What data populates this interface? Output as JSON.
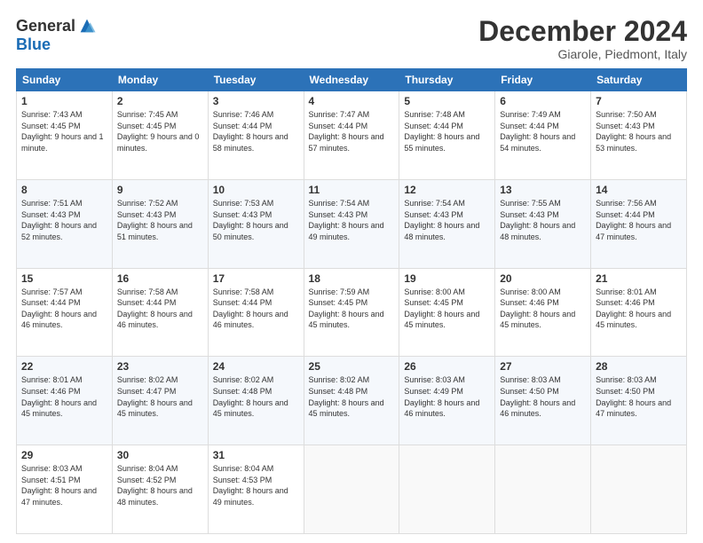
{
  "logo": {
    "general": "General",
    "blue": "Blue"
  },
  "title": {
    "month": "December 2024",
    "location": "Giarole, Piedmont, Italy"
  },
  "weekdays": [
    "Sunday",
    "Monday",
    "Tuesday",
    "Wednesday",
    "Thursday",
    "Friday",
    "Saturday"
  ],
  "weeks": [
    [
      {
        "day": "1",
        "sunrise": "7:43 AM",
        "sunset": "4:45 PM",
        "daylight": "9 hours and 1 minute."
      },
      {
        "day": "2",
        "sunrise": "7:45 AM",
        "sunset": "4:45 PM",
        "daylight": "9 hours and 0 minutes."
      },
      {
        "day": "3",
        "sunrise": "7:46 AM",
        "sunset": "4:44 PM",
        "daylight": "8 hours and 58 minutes."
      },
      {
        "day": "4",
        "sunrise": "7:47 AM",
        "sunset": "4:44 PM",
        "daylight": "8 hours and 57 minutes."
      },
      {
        "day": "5",
        "sunrise": "7:48 AM",
        "sunset": "4:44 PM",
        "daylight": "8 hours and 55 minutes."
      },
      {
        "day": "6",
        "sunrise": "7:49 AM",
        "sunset": "4:44 PM",
        "daylight": "8 hours and 54 minutes."
      },
      {
        "day": "7",
        "sunrise": "7:50 AM",
        "sunset": "4:43 PM",
        "daylight": "8 hours and 53 minutes."
      }
    ],
    [
      {
        "day": "8",
        "sunrise": "7:51 AM",
        "sunset": "4:43 PM",
        "daylight": "8 hours and 52 minutes."
      },
      {
        "day": "9",
        "sunrise": "7:52 AM",
        "sunset": "4:43 PM",
        "daylight": "8 hours and 51 minutes."
      },
      {
        "day": "10",
        "sunrise": "7:53 AM",
        "sunset": "4:43 PM",
        "daylight": "8 hours and 50 minutes."
      },
      {
        "day": "11",
        "sunrise": "7:54 AM",
        "sunset": "4:43 PM",
        "daylight": "8 hours and 49 minutes."
      },
      {
        "day": "12",
        "sunrise": "7:54 AM",
        "sunset": "4:43 PM",
        "daylight": "8 hours and 48 minutes."
      },
      {
        "day": "13",
        "sunrise": "7:55 AM",
        "sunset": "4:43 PM",
        "daylight": "8 hours and 48 minutes."
      },
      {
        "day": "14",
        "sunrise": "7:56 AM",
        "sunset": "4:44 PM",
        "daylight": "8 hours and 47 minutes."
      }
    ],
    [
      {
        "day": "15",
        "sunrise": "7:57 AM",
        "sunset": "4:44 PM",
        "daylight": "8 hours and 46 minutes."
      },
      {
        "day": "16",
        "sunrise": "7:58 AM",
        "sunset": "4:44 PM",
        "daylight": "8 hours and 46 minutes."
      },
      {
        "day": "17",
        "sunrise": "7:58 AM",
        "sunset": "4:44 PM",
        "daylight": "8 hours and 46 minutes."
      },
      {
        "day": "18",
        "sunrise": "7:59 AM",
        "sunset": "4:45 PM",
        "daylight": "8 hours and 45 minutes."
      },
      {
        "day": "19",
        "sunrise": "8:00 AM",
        "sunset": "4:45 PM",
        "daylight": "8 hours and 45 minutes."
      },
      {
        "day": "20",
        "sunrise": "8:00 AM",
        "sunset": "4:46 PM",
        "daylight": "8 hours and 45 minutes."
      },
      {
        "day": "21",
        "sunrise": "8:01 AM",
        "sunset": "4:46 PM",
        "daylight": "8 hours and 45 minutes."
      }
    ],
    [
      {
        "day": "22",
        "sunrise": "8:01 AM",
        "sunset": "4:46 PM",
        "daylight": "8 hours and 45 minutes."
      },
      {
        "day": "23",
        "sunrise": "8:02 AM",
        "sunset": "4:47 PM",
        "daylight": "8 hours and 45 minutes."
      },
      {
        "day": "24",
        "sunrise": "8:02 AM",
        "sunset": "4:48 PM",
        "daylight": "8 hours and 45 minutes."
      },
      {
        "day": "25",
        "sunrise": "8:02 AM",
        "sunset": "4:48 PM",
        "daylight": "8 hours and 45 minutes."
      },
      {
        "day": "26",
        "sunrise": "8:03 AM",
        "sunset": "4:49 PM",
        "daylight": "8 hours and 46 minutes."
      },
      {
        "day": "27",
        "sunrise": "8:03 AM",
        "sunset": "4:50 PM",
        "daylight": "8 hours and 46 minutes."
      },
      {
        "day": "28",
        "sunrise": "8:03 AM",
        "sunset": "4:50 PM",
        "daylight": "8 hours and 47 minutes."
      }
    ],
    [
      {
        "day": "29",
        "sunrise": "8:03 AM",
        "sunset": "4:51 PM",
        "daylight": "8 hours and 47 minutes."
      },
      {
        "day": "30",
        "sunrise": "8:04 AM",
        "sunset": "4:52 PM",
        "daylight": "8 hours and 48 minutes."
      },
      {
        "day": "31",
        "sunrise": "8:04 AM",
        "sunset": "4:53 PM",
        "daylight": "8 hours and 49 minutes."
      },
      null,
      null,
      null,
      null
    ]
  ]
}
